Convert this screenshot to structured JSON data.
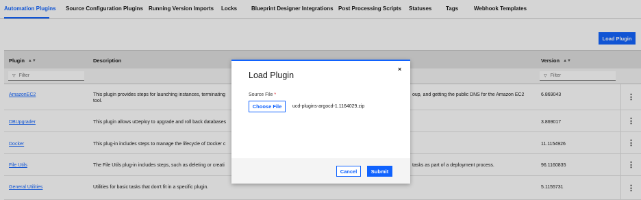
{
  "tabs": [
    {
      "label": "Automation Plugins"
    },
    {
      "label": "Source Configuration Plugins"
    },
    {
      "label": "Running Version Imports"
    },
    {
      "label": "Locks"
    },
    {
      "label": "Blueprint Designer Integrations"
    },
    {
      "label": "Post Processing Scripts"
    },
    {
      "label": "Statuses"
    },
    {
      "label": "Tags"
    },
    {
      "label": "Webhook Templates"
    }
  ],
  "toolbar": {
    "load_plugin_label": "Load Plugin"
  },
  "table": {
    "columns": {
      "plugin": "Plugin",
      "description": "Description",
      "version": "Version"
    },
    "filter_placeholder": "Filter",
    "rows": [
      {
        "plugin": "AmazonEC2",
        "description_left": "This plugin provides steps for launching instances, terminating",
        "description_right": "oup, and getting the public DNS for the Amazon EC2",
        "description_tail": "tool.",
        "version": "6.869043"
      },
      {
        "plugin": "DBUpgrader",
        "description_left": "This plugin allows uDeploy to upgrade and roll back databases",
        "description_right": "",
        "description_tail": "",
        "version": "3.869017"
      },
      {
        "plugin": "Docker",
        "description_left": "This plug-in includes steps to manage the lifecycle of Docker c",
        "description_right": "",
        "description_tail": "",
        "version": "11.1154926"
      },
      {
        "plugin": "File Utils",
        "description_left": "The File Utils plug-in includes steps, such as deleting or creati",
        "description_right": "tasks as part of a deployment process.",
        "description_tail": "",
        "version": "96.1160835"
      },
      {
        "plugin": "General Utilities",
        "description_left": "Utilities for basic tasks that don't fit in a specific plugin.",
        "description_right": "",
        "description_tail": "",
        "version": "5.1155731"
      }
    ]
  },
  "modal": {
    "title": "Load Plugin",
    "close_glyph": "×",
    "source_file_label": "Source File",
    "required_mark": "*",
    "choose_file_label": "Choose File",
    "file_name": "ucd-plugins-argocd-1.1164029.zip",
    "cancel_label": "Cancel",
    "submit_label": "Submit"
  },
  "colors": {
    "accent": "#0f62fe",
    "required": "#da1e28"
  }
}
